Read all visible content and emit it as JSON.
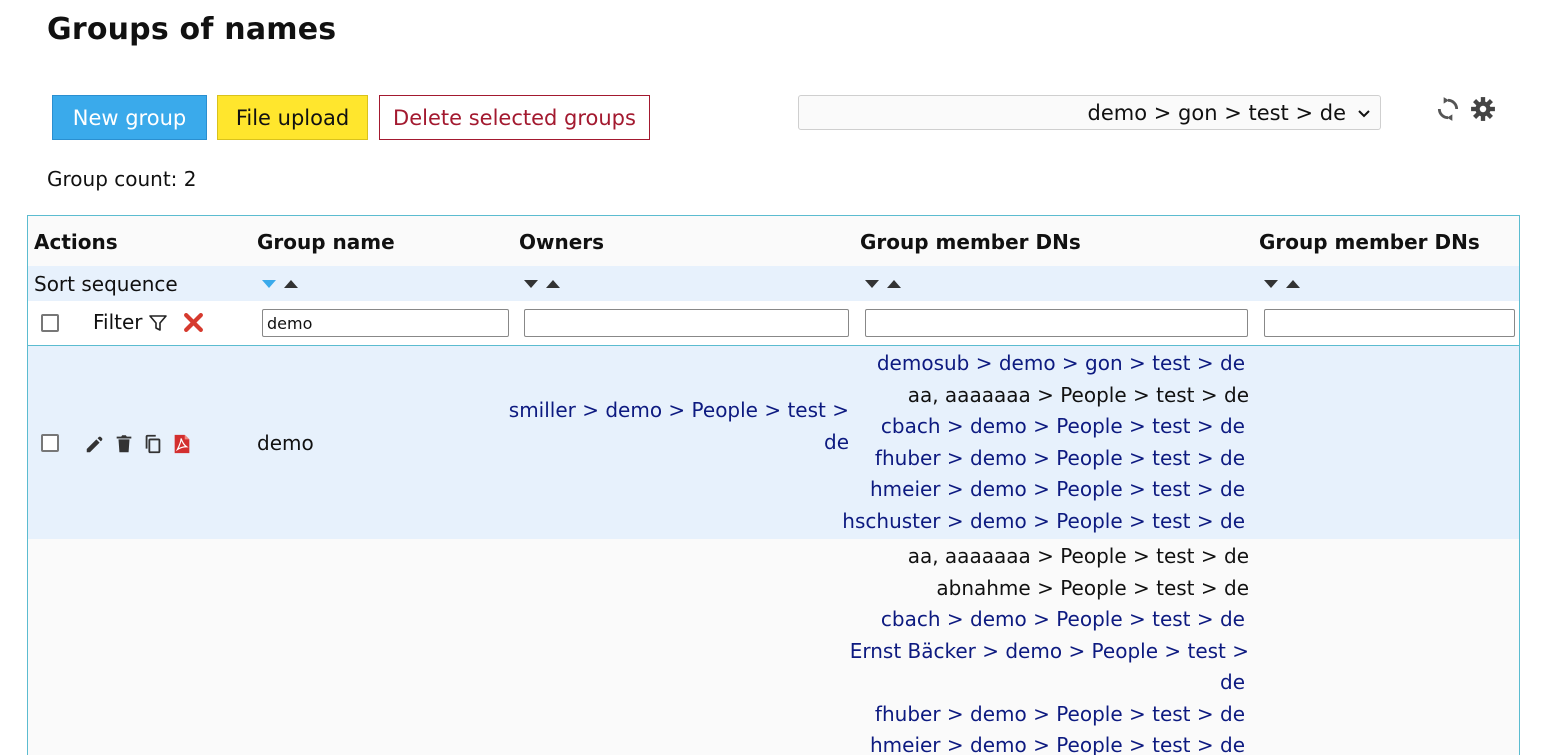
{
  "page": {
    "title": "Groups of names"
  },
  "toolbar": {
    "new_group": "New group",
    "file_upload": "File upload",
    "delete_selected": "Delete selected groups",
    "context_select": "demo > gon > test > de"
  },
  "group_count": "Group count: 2",
  "table": {
    "headers": {
      "actions": "Actions",
      "group_name": "Group name",
      "owners": "Owners",
      "members1": "Group member DNs",
      "members2": "Group member DNs"
    },
    "sort_label": "Sort sequence",
    "filter_label": "Filter",
    "filters": {
      "group_name": "demo",
      "owners": "",
      "members1": "",
      "members2": ""
    },
    "rows": [
      {
        "group_name": "demo",
        "owner_line1": "smiller > demo > People > test >",
        "owner_line2": "de",
        "members": [
          "demosub > demo > gon > test > de",
          "aa, aaaaaaa > People > test > de",
          "cbach > demo > People > test > de",
          "fhuber > demo > People > test > de",
          "hmeier > demo > People > test > de",
          "hschuster > demo > People > test > de"
        ]
      },
      {
        "group_name": "",
        "members": [
          "aa, aaaaaaa > People > test > de",
          "abnahme > People > test > de",
          "cbach > demo > People > test > de",
          "Ernst Bäcker > demo > People > test >",
          "de",
          "fhuber > demo > People > test > de",
          "hmeier > demo > People > test > de"
        ]
      }
    ]
  },
  "colors": {
    "primary": "#3aaaeb",
    "warning": "#ffe62d",
    "danger": "#a3192f",
    "link": "#0d1a80",
    "row_highlight": "#e7f1fc"
  }
}
